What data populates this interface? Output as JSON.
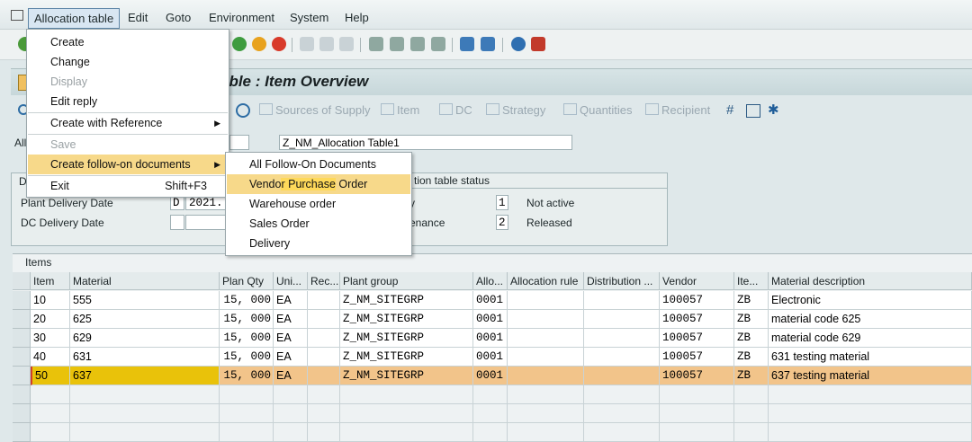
{
  "menubar": {
    "items": [
      "Allocation table",
      "Edit",
      "Goto",
      "Environment",
      "System",
      "Help"
    ]
  },
  "screen": {
    "title_visible": "able : Item Overview"
  },
  "app_toolbar": {
    "items": [
      "Sources of Supply",
      "Item",
      "DC",
      "Strategy",
      "Quantities",
      "Recipient"
    ]
  },
  "header": {
    "alloc_label": "All",
    "description": "Z_NM_Allocation Table1"
  },
  "dates": {
    "group_prefix": "D",
    "plant_delivery_label": "Plant Delivery Date",
    "plant_delivery_code": "D",
    "plant_delivery_value": "2021.",
    "dc_delivery_label": "DC Delivery Date"
  },
  "status_group": {
    "title": "tion table status",
    "row1_label": "y",
    "row1_value": "1",
    "row1_text": "Not active",
    "row2_label": "enance",
    "row2_value": "2",
    "row2_text": "Released"
  },
  "items_table": {
    "title": "Items",
    "columns": [
      "Item",
      "Material",
      "Plan Qty",
      "Uni...",
      "Rec...",
      "Plant group",
      "Allo...",
      "Allocation rule",
      "Distribution ...",
      "Vendor",
      "Ite...",
      "Material description"
    ],
    "rows": [
      {
        "item": "10",
        "material": "555",
        "qty": "15, 000",
        "unit": "EA",
        "plant_group": "Z_NM_SITEGRP",
        "alloc": "0001",
        "vendor": "100057",
        "itemcat": "ZB",
        "desc": "Electronic"
      },
      {
        "item": "20",
        "material": "625",
        "qty": "15, 000",
        "unit": "EA",
        "plant_group": "Z_NM_SITEGRP",
        "alloc": "0001",
        "vendor": "100057",
        "itemcat": "ZB",
        "desc": "material code 625"
      },
      {
        "item": "30",
        "material": "629",
        "qty": "15, 000",
        "unit": "EA",
        "plant_group": "Z_NM_SITEGRP",
        "alloc": "0001",
        "vendor": "100057",
        "itemcat": "ZB",
        "desc": "material code 629"
      },
      {
        "item": "40",
        "material": "631",
        "qty": "15, 000",
        "unit": "EA",
        "plant_group": "Z_NM_SITEGRP",
        "alloc": "0001",
        "vendor": "100057",
        "itemcat": "ZB",
        "desc": "631 testing material"
      },
      {
        "item": "50",
        "material": "637",
        "qty": "15, 000",
        "unit": "EA",
        "plant_group": "Z_NM_SITEGRP",
        "alloc": "0001",
        "vendor": "100057",
        "itemcat": "ZB",
        "desc": "637 testing material"
      }
    ]
  },
  "main_menu": {
    "create": "Create",
    "change": "Change",
    "display": "Display",
    "edit_reply": "Edit reply",
    "create_with_reference": "Create with Reference",
    "save": "Save",
    "create_follow_on": "Create follow-on documents",
    "exit": "Exit",
    "exit_shortcut": "Shift+F3"
  },
  "sub_menu": {
    "all_follow_on": "All Follow-On Documents",
    "vendor_po_part1": "Vendo",
    "vendor_po_hl": "r Purchase",
    "vendor_po_part2": " Order",
    "warehouse_order": "Warehouse order",
    "sales_order": "Sales Order",
    "delivery": "Delivery"
  },
  "colors": {
    "menu_highlight": "#f7d98a",
    "selected_row": "#f2c48a",
    "background": "#dfe8ea"
  }
}
